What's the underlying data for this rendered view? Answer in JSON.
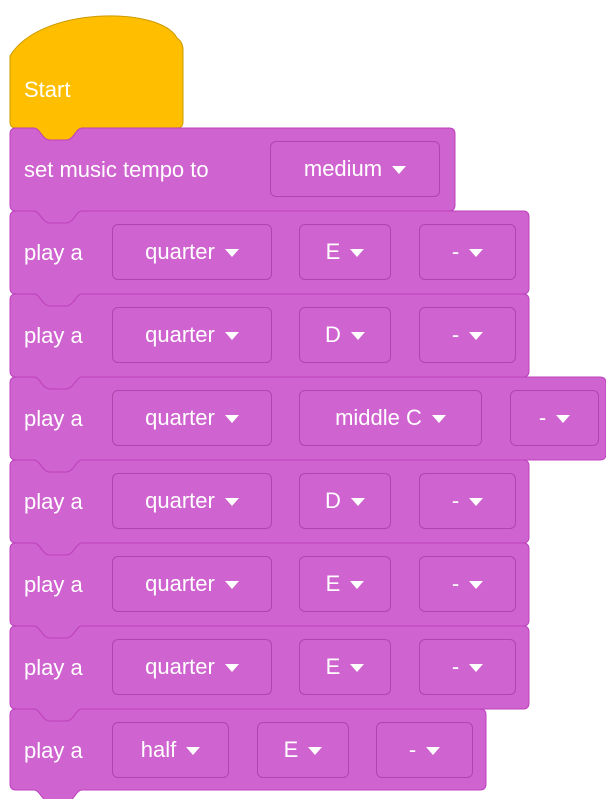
{
  "start_block": {
    "label": "Start",
    "color": "#FFBF00",
    "border_color": "#CC9900"
  },
  "tempo_block": {
    "label": "set music tempo to",
    "value": "medium"
  },
  "play_label": "play a",
  "play_blocks": [
    {
      "duration": "quarter",
      "note": "E",
      "modifier": "-"
    },
    {
      "duration": "quarter",
      "note": "D",
      "modifier": "-"
    },
    {
      "duration": "quarter",
      "note": "middle C",
      "modifier": "-"
    },
    {
      "duration": "quarter",
      "note": "D",
      "modifier": "-"
    },
    {
      "duration": "quarter",
      "note": "E",
      "modifier": "-"
    },
    {
      "duration": "quarter",
      "note": "E",
      "modifier": "-"
    },
    {
      "duration": "half",
      "note": "E",
      "modifier": "-"
    }
  ],
  "colors": {
    "block": "#CF63CF",
    "block_border": "#BD42BD",
    "text": "#FFFFFF"
  }
}
